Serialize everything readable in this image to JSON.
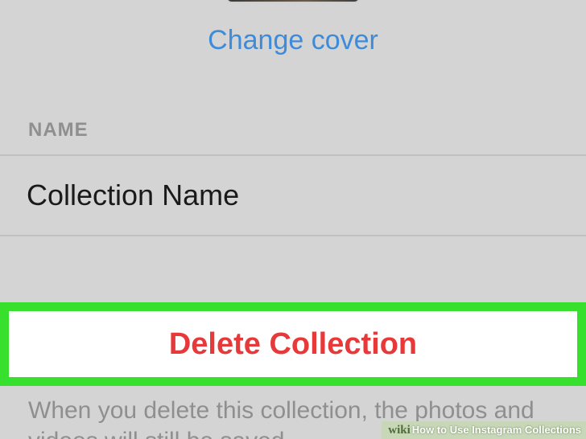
{
  "cover": {
    "change_label": "Change cover"
  },
  "name_section": {
    "label": "NAME",
    "value": "Collection Name"
  },
  "delete": {
    "label": "Delete Collection",
    "highlight_color": "#38e02e",
    "text_color": "#e8393a"
  },
  "helper": {
    "text": "When you delete this collection, the photos and videos will still be saved"
  },
  "watermark": {
    "brand": "wiki",
    "title": "How to Use Instagram Collections"
  }
}
